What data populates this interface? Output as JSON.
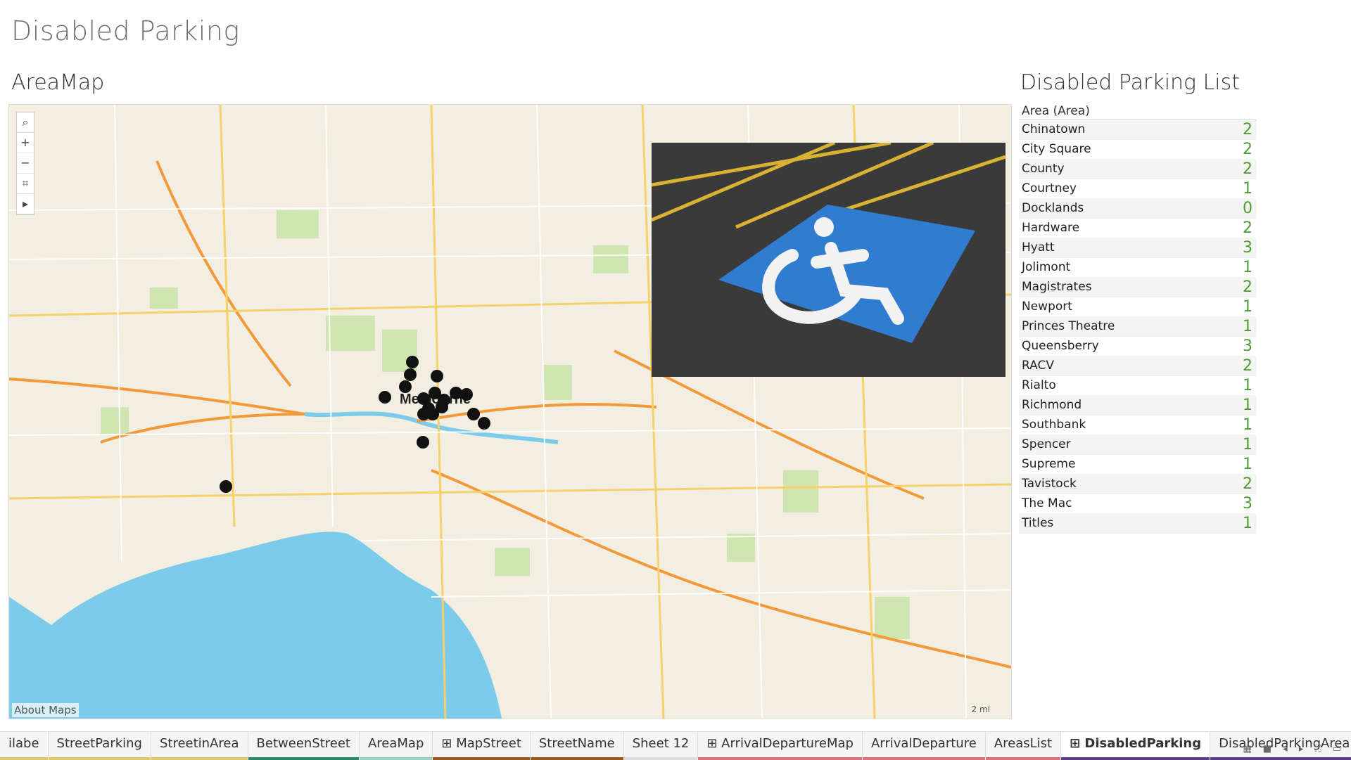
{
  "page_title": "Disabled Parking",
  "map_title": "AreaMap",
  "list_title": "Disabled Parking List",
  "map": {
    "attribution": "About Maps",
    "scale": "2 mi",
    "city_label": "Melbourne",
    "controls": [
      "search-icon",
      "zoom-in-icon",
      "zoom-out-icon",
      "lasso-icon",
      "play-icon"
    ]
  },
  "list": {
    "header": "Area (Area)",
    "rows": [
      {
        "area": "Chinatown",
        "count": "2"
      },
      {
        "area": "City Square",
        "count": "2"
      },
      {
        "area": "County",
        "count": "2"
      },
      {
        "area": "Courtney",
        "count": "1"
      },
      {
        "area": "Docklands",
        "count": "0"
      },
      {
        "area": "Hardware",
        "count": "2"
      },
      {
        "area": "Hyatt",
        "count": "3"
      },
      {
        "area": "Jolimont",
        "count": "1"
      },
      {
        "area": "Magistrates",
        "count": "2"
      },
      {
        "area": "Newport",
        "count": "1"
      },
      {
        "area": "Princes Theatre",
        "count": "1"
      },
      {
        "area": "Queensberry",
        "count": "3"
      },
      {
        "area": "RACV",
        "count": "2"
      },
      {
        "area": "Rialto",
        "count": "1"
      },
      {
        "area": "Richmond",
        "count": "1"
      },
      {
        "area": "Southbank",
        "count": "1"
      },
      {
        "area": "Spencer",
        "count": "1"
      },
      {
        "area": "Supreme",
        "count": "1"
      },
      {
        "area": "Tavistock",
        "count": "2"
      },
      {
        "area": "The Mac",
        "count": "3"
      },
      {
        "area": "Titles",
        "count": "1"
      }
    ]
  },
  "tabs": [
    {
      "label": "ilabe",
      "color": "#e0c86a",
      "active": false
    },
    {
      "label": "StreetParking",
      "color": "#e0c86a",
      "active": false
    },
    {
      "label": "StreetinArea",
      "color": "#e0c86a",
      "active": false
    },
    {
      "label": "BetweenStreet",
      "color": "#2a8a6a",
      "active": false
    },
    {
      "label": "AreaMap",
      "color": "#9ad1c8",
      "active": false
    },
    {
      "label": "⊞ MapStreet",
      "color": "#9a5a18",
      "active": false
    },
    {
      "label": "StreetName",
      "color": "#9a5a18",
      "active": false
    },
    {
      "label": "Sheet 12",
      "color": "#dddddd",
      "active": false
    },
    {
      "label": "⊞ ArrivalDepartureMap",
      "color": "#e07080",
      "active": false
    },
    {
      "label": "ArrivalDeparture",
      "color": "#e07080",
      "active": false
    },
    {
      "label": "AreasList",
      "color": "#e07080",
      "active": false
    },
    {
      "label": "⊞ DisabledParking",
      "color": "#5a3f8a",
      "active": true
    },
    {
      "label": "DisabledParkingArea",
      "color": "#5a3f8a",
      "active": false
    }
  ],
  "colors": {
    "count_green": "#4c9e33",
    "water": "#7ccbea",
    "park": "#c6e2a8",
    "dot": "#111111"
  }
}
